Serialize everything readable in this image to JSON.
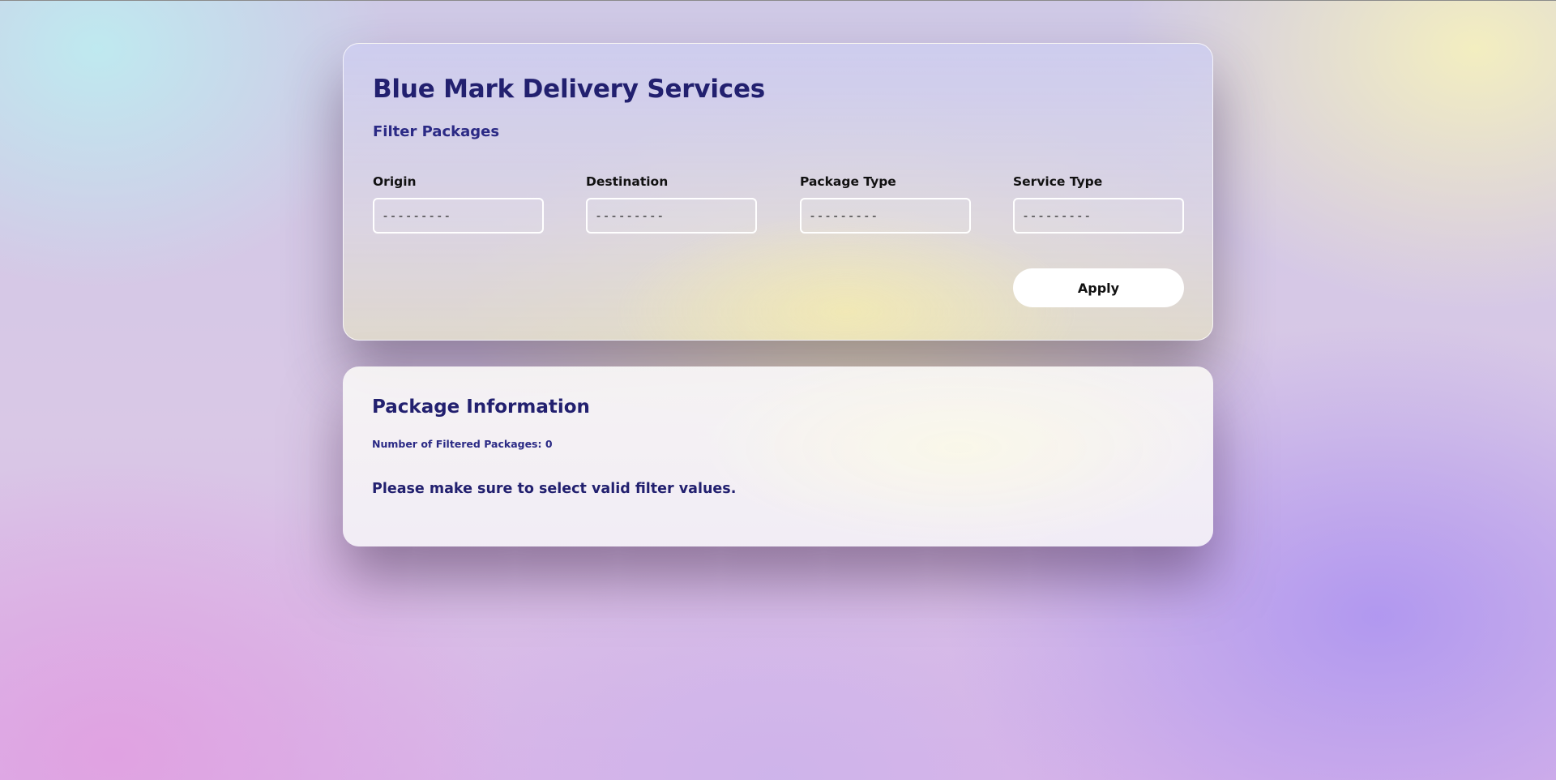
{
  "app": {
    "title": "Blue Mark Delivery Services"
  },
  "filter": {
    "section_title": "Filter Packages",
    "fields": [
      {
        "label": "Origin",
        "value": "---------"
      },
      {
        "label": "Destination",
        "value": "---------"
      },
      {
        "label": "Package Type",
        "value": "---------"
      },
      {
        "label": "Service Type",
        "value": "---------"
      }
    ],
    "apply_label": "Apply"
  },
  "info": {
    "title": "Package Information",
    "count_label": "Number of Filtered Packages: 0",
    "message": "Please make sure to select valid filter values."
  },
  "colors": {
    "heading": "#22206f",
    "subheading": "#2b2a85",
    "button_bg": "#ffffff"
  }
}
